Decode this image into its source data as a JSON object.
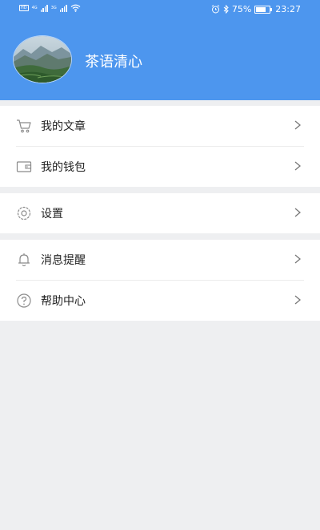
{
  "status_bar": {
    "left_label_1": "HD",
    "left_label_2": "4G",
    "left_label_3": "3G",
    "battery": "75%",
    "battery_level": 0.75,
    "time": "23:27"
  },
  "profile": {
    "username": "茶语清心"
  },
  "menu": {
    "group1": [
      {
        "label": "我的文章",
        "icon": "cart-icon"
      },
      {
        "label": "我的钱包",
        "icon": "wallet-icon"
      }
    ],
    "group2": [
      {
        "label": "设置",
        "icon": "gear-icon"
      }
    ],
    "group3": [
      {
        "label": "消息提醒",
        "icon": "bell-icon"
      },
      {
        "label": "帮助中心",
        "icon": "question-icon"
      }
    ]
  },
  "colors": {
    "header_bg": "#4d96ee",
    "page_bg": "#eeeff1"
  }
}
